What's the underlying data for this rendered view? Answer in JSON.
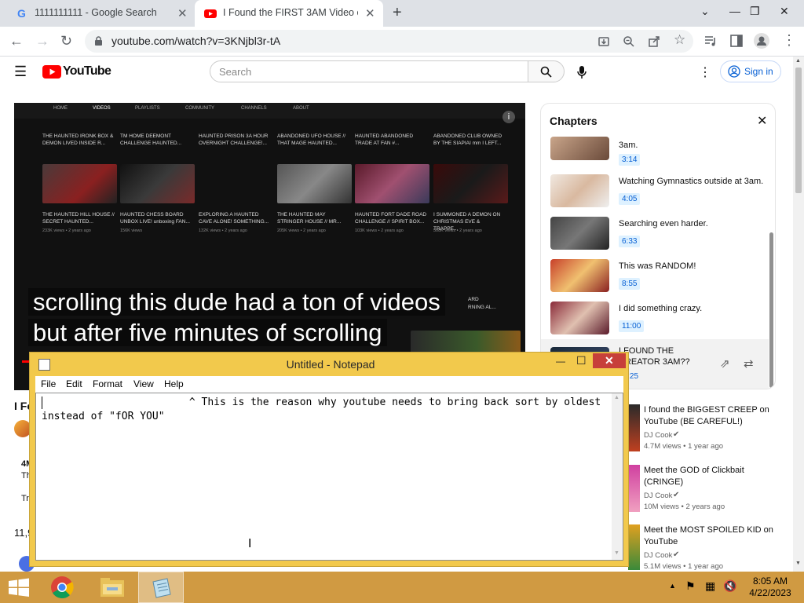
{
  "browser": {
    "tabs": [
      {
        "title": "1111111111 - Google Search",
        "icon": "google-icon"
      },
      {
        "title": "I Found the FIRST 3AM Video on",
        "icon": "youtube-icon"
      }
    ],
    "url": "youtube.com/watch?v=3KNjbl3r-tA"
  },
  "youtube": {
    "logo_text": "YouTube",
    "search_placeholder": "Search",
    "signin_label": "Sign in",
    "video": {
      "channel_tabs": [
        "HOME",
        "VIDEOS",
        "PLAYLISTS",
        "COMMUNITY",
        "CHANNELS",
        "ABOUT"
      ],
      "grid_row1": [
        "THE HAUNTED IRONK BOX & DEMON LIVED INSIDE R...",
        "TM HOME DEEMONT CHALLENGE HAUNTED...",
        "HAUNTED PRISON 3A HOUR OVERNIGHT CHALLENGE!...",
        "ABANDONED UFO HOUSE // THAT MAGE HAUNTED...",
        "HAUNTED ABANDONED TRADE AT FAN #...",
        "ABANDONED CLUB OWNED BY THE SIAPIAI mm I LEFT..."
      ],
      "grid_row2": [
        {
          "title": "THE HAUNTED HILL HOUSE // SECRET HAUNTED...",
          "meta": "233K views • 2 years ago"
        },
        {
          "title": "HAUNTED CHESS BOARD UNBOX LIVE! unboxing FAN...",
          "meta": "156K views"
        },
        {
          "title": "EXPLORING A HAUNTED CAVE ALONE! SOMETHING...",
          "meta": "132K views • 2 years ago"
        },
        {
          "title": "THE HAUNTED MAY STRINGER HOUSE // MR...",
          "meta": "205K views • 2 years ago"
        },
        {
          "title": "HAUNTED FORT DADE ROAD CHALLENGE // SPIRIT BOX...",
          "meta": "103K views • 2 years ago"
        },
        {
          "title": "I SUMMONED A DEMON ON CHRISTMAS EVE & TRAPPE...",
          "meta": "508K views • 2 years ago"
        }
      ],
      "caption_line1": "scrolling this dude had a ton of videos",
      "caption_line2": "but after five minutes of scrolling",
      "side_text_1": "ARD",
      "side_text_2": "RNING AL..."
    },
    "chapters": {
      "title": "Chapters",
      "items": [
        {
          "title": "3am.",
          "time": "3:14"
        },
        {
          "title": "Watching Gymnastics outside at 3am.",
          "time": "4:05"
        },
        {
          "title": "Searching even harder.",
          "time": "6:33"
        },
        {
          "title": "This was RANDOM!",
          "time": "8:55"
        },
        {
          "title": "I did something crazy.",
          "time": "11:00"
        },
        {
          "title": "I FOUND THE CREATOR 3AM??",
          "time": "12:25"
        }
      ]
    },
    "below_video": {
      "title_fragment": "I Fo",
      "views_fragment": "4M",
      "text_fragment_1": "Th",
      "text_fragment_2": "Tr",
      "likes_fragment": "11,9"
    },
    "recommendations": [
      {
        "title": "I found the BIGGEST CREEP on YouTube (BE CAREFUL!)",
        "channel": "DJ Cook",
        "meta": "4.7M views • 1 year ago"
      },
      {
        "title": "Meet the GOD of Clickbait (CRINGE)",
        "channel": "DJ Cook",
        "meta": "10M views • 2 years ago"
      },
      {
        "title": "Meet the MOST SPOILED KID on YouTube",
        "channel": "DJ Cook",
        "meta": "5.1M views • 1 year ago"
      }
    ]
  },
  "notepad": {
    "title": "Untitled - Notepad",
    "menu": [
      "File",
      "Edit",
      "Format",
      "View",
      "Help"
    ],
    "text": "                        ^ This is the reason why youtube needs to bring back sort by oldest instead of \"fOR YOU\""
  },
  "taskbar": {
    "time": "8:05 AM",
    "date": "4/22/2023"
  },
  "colors": {
    "youtube_red": "#ff0000",
    "link_blue": "#065fd4",
    "notepad_frame": "#f2c94c",
    "taskbar": "#d09a42"
  }
}
